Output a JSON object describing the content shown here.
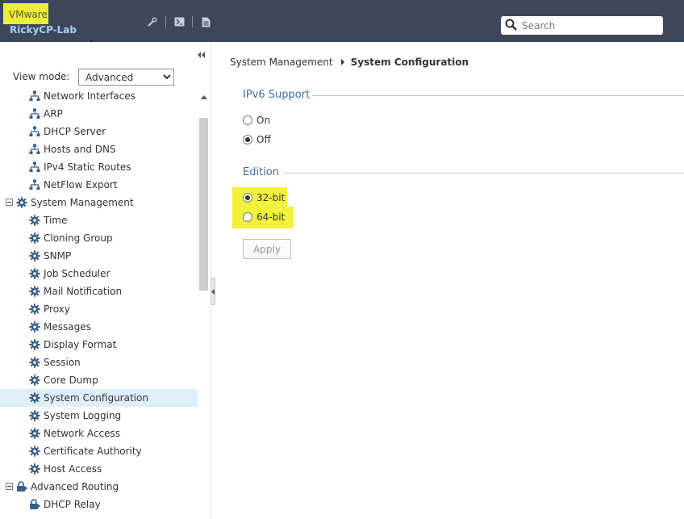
{
  "header": {
    "vendor": "VMware",
    "hostname": "RickyCP-Lab",
    "icons": [
      "wrench-icon",
      "terminal-icon",
      "document-icon"
    ],
    "search_placeholder": "Search"
  },
  "sidebar": {
    "view_mode_label": "View mode:",
    "view_mode_value": "Advanced",
    "items": [
      {
        "label": "Network Interfaces",
        "icon": "network-icon",
        "level": 1
      },
      {
        "label": "ARP",
        "icon": "network-icon",
        "level": 1
      },
      {
        "label": "DHCP Server",
        "icon": "network-icon",
        "level": 1
      },
      {
        "label": "Hosts and DNS",
        "icon": "network-icon",
        "level": 1
      },
      {
        "label": "IPv4 Static Routes",
        "icon": "network-icon",
        "level": 1
      },
      {
        "label": "NetFlow Export",
        "icon": "network-icon",
        "level": 1
      },
      {
        "label": "System Management",
        "icon": "gear-icon",
        "level": 0,
        "expanded": true
      },
      {
        "label": "Time",
        "icon": "gear-icon",
        "level": 1
      },
      {
        "label": "Cloning Group",
        "icon": "gear-icon",
        "level": 1
      },
      {
        "label": "SNMP",
        "icon": "gear-icon",
        "level": 1
      },
      {
        "label": "Job Scheduler",
        "icon": "gear-icon",
        "level": 1
      },
      {
        "label": "Mail Notification",
        "icon": "gear-icon",
        "level": 1
      },
      {
        "label": "Proxy",
        "icon": "gear-icon",
        "level": 1
      },
      {
        "label": "Messages",
        "icon": "gear-icon",
        "level": 1
      },
      {
        "label": "Display Format",
        "icon": "gear-icon",
        "level": 1
      },
      {
        "label": "Session",
        "icon": "gear-icon",
        "level": 1
      },
      {
        "label": "Core Dump",
        "icon": "gear-icon",
        "level": 1
      },
      {
        "label": "System Configuration",
        "icon": "gear-icon",
        "level": 1,
        "selected": true
      },
      {
        "label": "System Logging",
        "icon": "gear-icon",
        "level": 1
      },
      {
        "label": "Network Access",
        "icon": "gear-icon",
        "level": 1
      },
      {
        "label": "Certificate Authority",
        "icon": "gear-icon",
        "level": 1
      },
      {
        "label": "Host Access",
        "icon": "gear-icon",
        "level": 1
      },
      {
        "label": "Advanced Routing",
        "icon": "routing-icon",
        "level": 0,
        "expanded": true
      },
      {
        "label": "DHCP Relay",
        "icon": "routing-icon",
        "level": 1
      }
    ]
  },
  "breadcrumb": {
    "parent": "System Management",
    "current": "System Configuration"
  },
  "ipv6": {
    "title": "IPv6 Support",
    "on_label": "On",
    "off_label": "Off",
    "selected": "off"
  },
  "edition": {
    "title": "Edition",
    "opt32_label": "32-bit",
    "opt64_label": "64-bit",
    "selected": "32"
  },
  "apply_label": "Apply",
  "colors": {
    "header_bg": "#3c4759",
    "highlight": "#f2f23a",
    "selected_row": "#deeefb",
    "section_title": "#3b6e9e"
  }
}
